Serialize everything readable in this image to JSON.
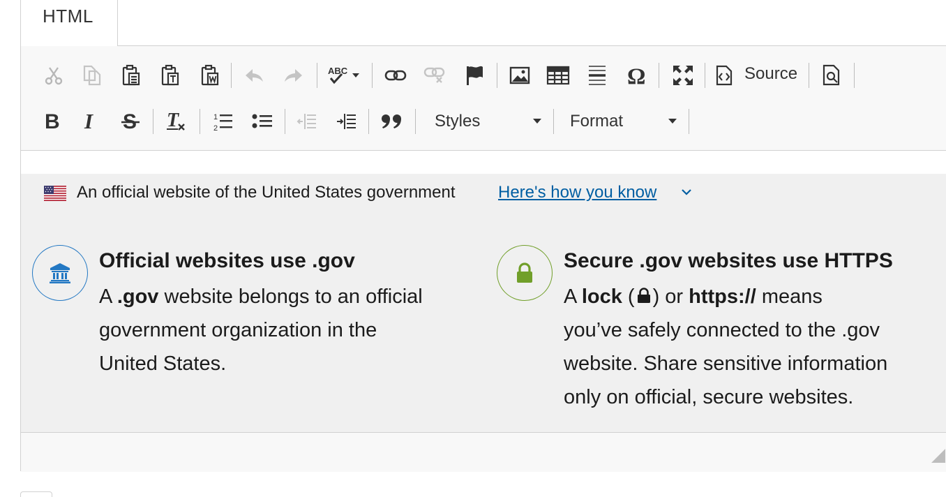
{
  "tab": {
    "label": "HTML"
  },
  "toolbar": {
    "row1": [
      {
        "name": "cut-icon",
        "enabled": false
      },
      {
        "name": "copy-icon",
        "enabled": false
      },
      {
        "name": "paste-icon",
        "enabled": true
      },
      {
        "name": "paste-text-icon",
        "enabled": true
      },
      {
        "name": "paste-from-word-icon",
        "enabled": true
      },
      {
        "name": "undo-icon",
        "enabled": false
      },
      {
        "name": "redo-icon",
        "enabled": false
      },
      {
        "name": "spellcheck-icon",
        "enabled": true
      },
      {
        "name": "link-icon",
        "enabled": true
      },
      {
        "name": "unlink-icon",
        "enabled": false
      },
      {
        "name": "anchor-icon",
        "enabled": true
      },
      {
        "name": "image-icon",
        "enabled": true
      },
      {
        "name": "table-icon",
        "enabled": true
      },
      {
        "name": "horizontal-line-icon",
        "enabled": true
      },
      {
        "name": "special-char-icon",
        "enabled": true
      },
      {
        "name": "maximize-icon",
        "enabled": true
      },
      {
        "name": "source-icon",
        "enabled": true
      },
      {
        "name": "preview-icon",
        "enabled": true
      }
    ],
    "source_label": "Source",
    "styles_label": "Styles",
    "format_label": "Format"
  },
  "banner": {
    "official_text": "An official website of the United States government",
    "how_link": "Here's how you know"
  },
  "guides": {
    "gov": {
      "title": "Official websites use .gov",
      "body_pre": "A ",
      "body_bold": ".gov",
      "body_post_1": " website belongs to an official",
      "body_line2": "government organization in the",
      "body_line3": "United States."
    },
    "https": {
      "title": "Secure .gov websites use HTTPS",
      "body_pre": "A ",
      "lock_word": "lock",
      "paren_open": " (",
      "paren_close": ") or ",
      "https_word": "https://",
      "body_post_1": " means",
      "body_line2": "you’ve safely connected to the .gov",
      "body_line3": "website. Share sensitive information",
      "body_line4": "only on official, secure websites."
    }
  },
  "colors": {
    "link": "#005ea2",
    "gov_icon": "#2378c3",
    "https_icon": "#719f2a",
    "banner_bg": "#f0f0f0"
  }
}
